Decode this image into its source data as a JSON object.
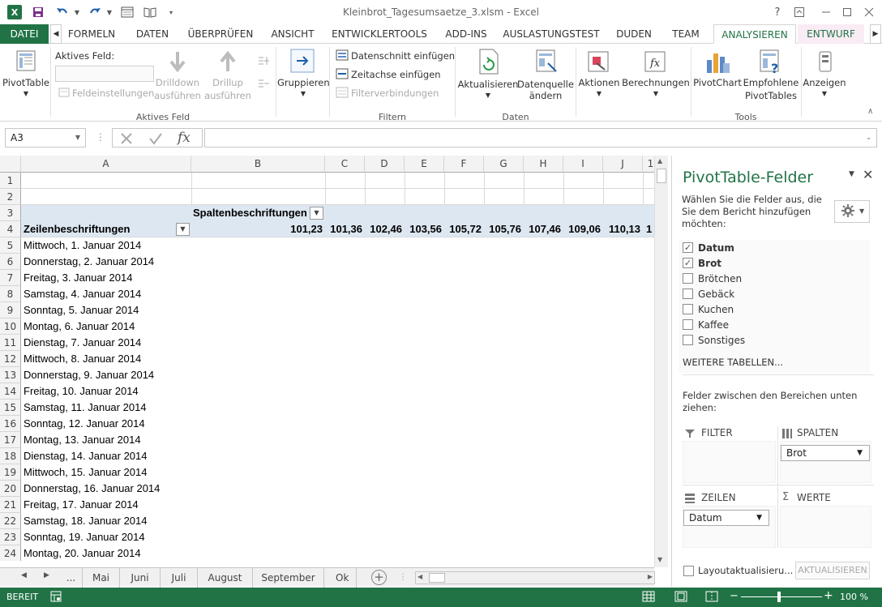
{
  "window": {
    "title": "Kleinbrot_Tagesumsaetze_3.xlsm - Excel",
    "help_label": "?"
  },
  "tabs": [
    {
      "label": "DATEI"
    },
    {
      "label": "FORMELN"
    },
    {
      "label": "DATEN"
    },
    {
      "label": "ÜBERPRÜFEN"
    },
    {
      "label": "ANSICHT"
    },
    {
      "label": "ENTWICKLERTOOLS"
    },
    {
      "label": "ADD-INS"
    },
    {
      "label": "AUSLASTUNGSTEST"
    },
    {
      "label": "DUDEN"
    },
    {
      "label": "TEAM"
    },
    {
      "label": "ANALYSIEREN"
    },
    {
      "label": "ENTWURF"
    }
  ],
  "ribbon": {
    "pivottable": "PivotTable",
    "active_field_label": "Aktives Feld:",
    "field_settings": "Feldeinstellungen",
    "drilldown": [
      "Drilldown",
      "ausführen"
    ],
    "drillup": [
      "Drillup",
      "ausführen"
    ],
    "group_active_field": "Aktives Feld",
    "gruppieren": "Gruppieren",
    "slicer": "Datenschnitt einfügen",
    "timeline": "Zeitachse einfügen",
    "filter_connections": "Filterverbindungen",
    "group_filter": "Filtern",
    "refresh": "Aktualisieren",
    "change_source": [
      "Datenquelle",
      "ändern"
    ],
    "group_data": "Daten",
    "actions": "Aktionen",
    "calculations": "Berechnungen",
    "pivotchart": "PivotChart",
    "recommended": [
      "Empfohlene",
      "PivotTables"
    ],
    "group_tools": "Tools",
    "show": "Anzeigen"
  },
  "formula_bar": {
    "name_box": "A3",
    "fx": "fx",
    "content": ""
  },
  "grid": {
    "columns": [
      "A",
      "B",
      "C",
      "D",
      "E",
      "F",
      "G",
      "H",
      "I",
      "J",
      "1"
    ],
    "row_numbers": [
      "1",
      "2",
      "3",
      "4",
      "5",
      "6",
      "7",
      "8",
      "9",
      "10",
      "11",
      "12",
      "13",
      "14",
      "15",
      "16",
      "17",
      "18",
      "19",
      "20",
      "21",
      "22",
      "23",
      "24"
    ],
    "col_labels_header": "Spaltenbeschriftungen",
    "row_labels_header": "Zeilenbeschriftungen",
    "col_values": [
      "101,23",
      "101,36",
      "102,46",
      "103,56",
      "105,72",
      "105,76",
      "107,46",
      "109,06",
      "110,13",
      "1"
    ],
    "row_items": [
      "Mittwoch, 1. Januar 2014",
      "Donnerstag, 2. Januar 2014",
      "Freitag, 3. Januar 2014",
      "Samstag, 4. Januar 2014",
      "Sonntag, 5. Januar 2014",
      "Montag, 6. Januar 2014",
      "Dienstag, 7. Januar 2014",
      "Mittwoch, 8. Januar 2014",
      "Donnerstag, 9. Januar 2014",
      "Freitag, 10. Januar 2014",
      "Samstag, 11. Januar 2014",
      "Sonntag, 12. Januar 2014",
      "Montag, 13. Januar 2014",
      "Dienstag, 14. Januar 2014",
      "Mittwoch, 15. Januar 2014",
      "Donnerstag, 16. Januar 2014",
      "Freitag, 17. Januar 2014",
      "Samstag, 18. Januar 2014",
      "Sonntag, 19. Januar 2014",
      "Montag, 20. Januar 2014"
    ]
  },
  "sheet_tabs": [
    "...",
    "Mai",
    "Juni",
    "Juli",
    "August",
    "September",
    "Ok"
  ],
  "pane": {
    "title": "PivotTable-Felder",
    "description": "Wählen Sie die Felder aus, die Sie dem Bericht hinzufügen möchten:",
    "fields": [
      {
        "label": "Datum",
        "checked": true
      },
      {
        "label": "Brot",
        "checked": true
      },
      {
        "label": "Brötchen",
        "checked": false
      },
      {
        "label": "Gebäck",
        "checked": false
      },
      {
        "label": "Kuchen",
        "checked": false
      },
      {
        "label": "Kaffee",
        "checked": false
      },
      {
        "label": "Sonstiges",
        "checked": false
      }
    ],
    "more_tables": "WEITERE TABELLEN...",
    "drag_hint": "Felder zwischen den Bereichen unten ziehen:",
    "filter_label": "FILTER",
    "columns_label": "SPALTEN",
    "rows_label": "ZEILEN",
    "values_label": "WERTE",
    "columns_field": "Brot",
    "rows_field": "Datum",
    "defer_update": "Layoutaktualisieru...",
    "update_button": "AKTUALISIEREN"
  },
  "status": {
    "mode": "BEREIT",
    "zoom": "100 %"
  },
  "colors": {
    "excel_green": "#217346",
    "pivot_header_fill": "#dde7f1"
  }
}
